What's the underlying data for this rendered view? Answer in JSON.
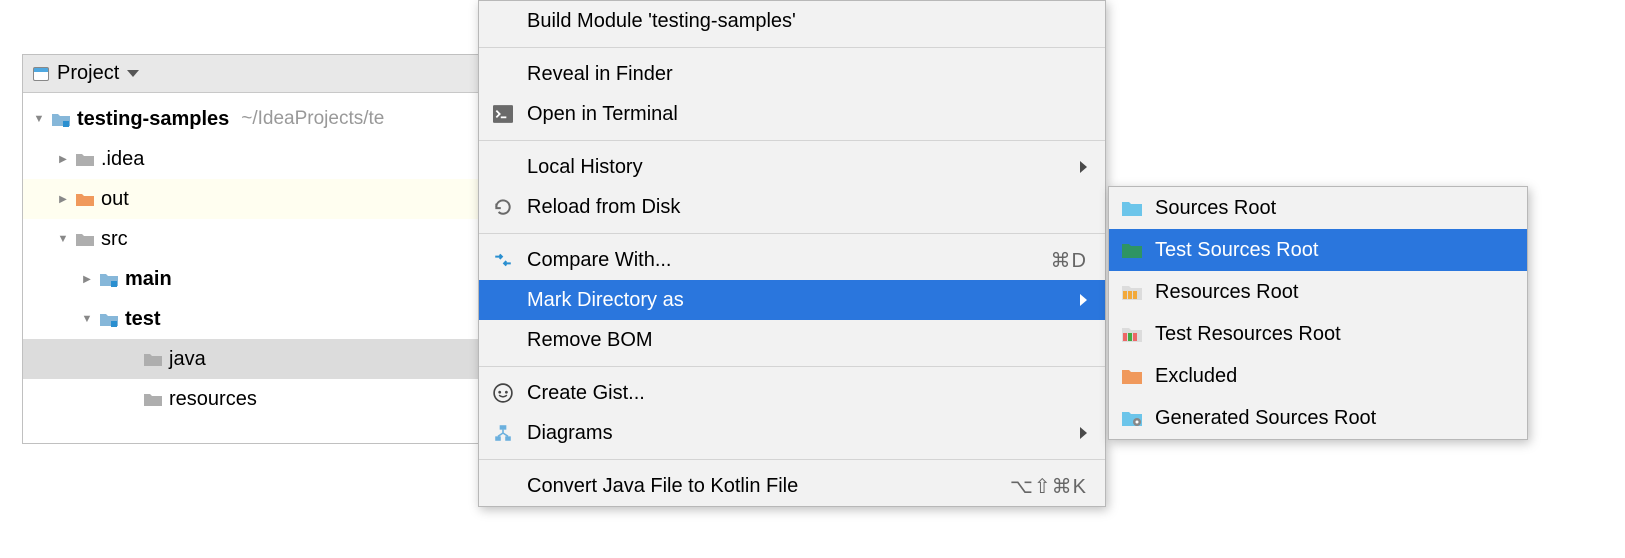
{
  "panel": {
    "title": "Project"
  },
  "tree": {
    "root": {
      "label": "testing-samples",
      "hint": "~/IdeaProjects/te"
    },
    "items": [
      {
        "label": ".idea"
      },
      {
        "label": "out"
      },
      {
        "label": "src"
      },
      {
        "label": "main"
      },
      {
        "label": "test"
      },
      {
        "label": "java"
      },
      {
        "label": "resources"
      }
    ]
  },
  "context_menu": {
    "items": [
      {
        "label": "Build Module 'testing-samples'"
      },
      {
        "label": "Reveal in Finder"
      },
      {
        "label": "Open in Terminal"
      },
      {
        "label": "Local History"
      },
      {
        "label": "Reload from Disk"
      },
      {
        "label": "Compare With...",
        "shortcut": "⌘D"
      },
      {
        "label": "Mark Directory as"
      },
      {
        "label": "Remove BOM"
      },
      {
        "label": "Create Gist..."
      },
      {
        "label": "Diagrams"
      },
      {
        "label": "Convert Java File to Kotlin File",
        "shortcut": "⌥⇧⌘K"
      }
    ]
  },
  "submenu": {
    "items": [
      {
        "label": "Sources Root"
      },
      {
        "label": "Test Sources Root"
      },
      {
        "label": "Resources Root"
      },
      {
        "label": "Test Resources Root"
      },
      {
        "label": "Excluded"
      },
      {
        "label": "Generated Sources Root"
      }
    ]
  }
}
